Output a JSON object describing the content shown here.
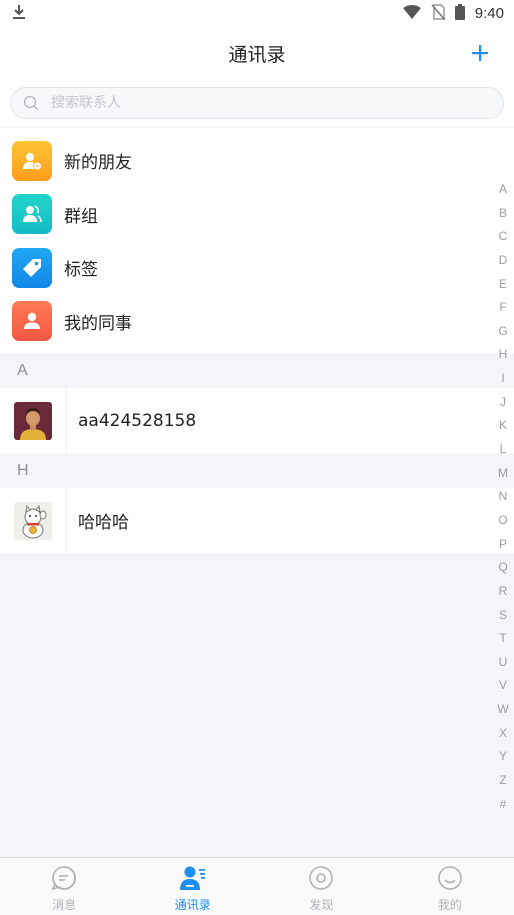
{
  "status_bar": {
    "time": "9:40"
  },
  "nav": {
    "title": "通讯录"
  },
  "search": {
    "placeholder": "搜索联系人"
  },
  "features": [
    {
      "label": "新的朋友",
      "icon": "new-friend-icon",
      "color": "#ffb22a"
    },
    {
      "label": "群组",
      "icon": "group-icon",
      "color": "#1cc9c5"
    },
    {
      "label": "标签",
      "icon": "tag-icon",
      "color": "#1597f0"
    },
    {
      "label": "我的同事",
      "icon": "colleague-icon",
      "color": "#fb6b4d"
    }
  ],
  "sections": [
    {
      "letter": "A",
      "contacts": [
        {
          "name": "aa424528158",
          "avatar": "illustrated-person-avatar"
        }
      ]
    },
    {
      "letter": "H",
      "contacts": [
        {
          "name": "哈哈哈",
          "avatar": "lucky-cat-avatar"
        }
      ]
    }
  ],
  "index_letters": [
    "A",
    "B",
    "C",
    "D",
    "E",
    "F",
    "G",
    "H",
    "I",
    "J",
    "K",
    "L",
    "M",
    "N",
    "O",
    "P",
    "Q",
    "R",
    "S",
    "T",
    "U",
    "V",
    "W",
    "X",
    "Y",
    "Z",
    "#"
  ],
  "tabs": [
    {
      "label": "消息",
      "icon": "message-icon",
      "active": false
    },
    {
      "label": "通讯录",
      "icon": "contacts-icon",
      "active": true
    },
    {
      "label": "发现",
      "icon": "discover-icon",
      "active": false
    },
    {
      "label": "我的",
      "icon": "profile-icon",
      "active": false
    }
  ],
  "colors": {
    "accent": "#1e8ff0",
    "background": "#f4f5f9"
  }
}
